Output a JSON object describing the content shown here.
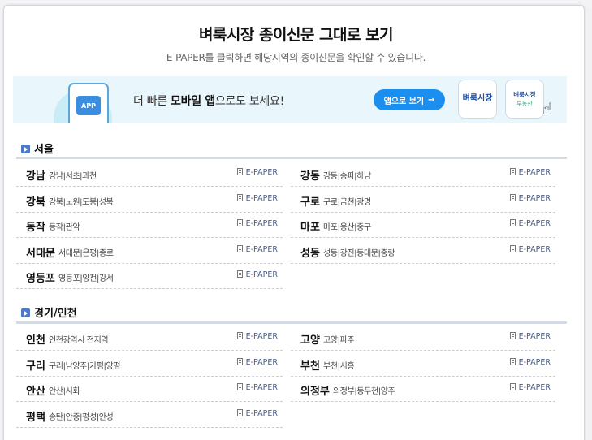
{
  "header": {
    "title": "벼룩시장 종이신문 그대로 보기",
    "subtitle": "E-PAPER를 클릭하면 해당지역의 종이신문을 확인할 수 있습니다."
  },
  "banner": {
    "app_icon_label": "APP",
    "text_before": "더 빠른 ",
    "text_bold": "모바일 앱",
    "text_after": "으로도 보세요!",
    "button_label": "앱으로 보기",
    "button_arrow": "→",
    "tile1_label": "벼룩시장",
    "tile2_label": "벼룩시장",
    "tile2_sub": "부동산",
    "hand_glyph": "☝"
  },
  "epaper_label": "E-PAPER",
  "sections": [
    {
      "title": "서울",
      "left": [
        {
          "city": "강남",
          "areas": "강남|서초|과천"
        },
        {
          "city": "강북",
          "areas": "강북|노원|도봉|성북"
        },
        {
          "city": "동작",
          "areas": "동작|관악"
        },
        {
          "city": "서대문",
          "areas": "서대문|은평|종로"
        },
        {
          "city": "영등포",
          "areas": "영등포|양천|강서"
        }
      ],
      "right": [
        {
          "city": "강동",
          "areas": "강동|송파|하남"
        },
        {
          "city": "구로",
          "areas": "구로|금천|광명"
        },
        {
          "city": "마포",
          "areas": "마포|용산|중구"
        },
        {
          "city": "성동",
          "areas": "성동|광진|동대문|중랑"
        }
      ]
    },
    {
      "title": "경기/인천",
      "left": [
        {
          "city": "인천",
          "areas": "인천광역시 전지역"
        },
        {
          "city": "구리",
          "areas": "구리|남양주|가평|양평"
        },
        {
          "city": "안산",
          "areas": "안산|시화"
        },
        {
          "city": "평택",
          "areas": "송탄|안중|평성|안성"
        }
      ],
      "right": [
        {
          "city": "고양",
          "areas": "고양|파주"
        },
        {
          "city": "부천",
          "areas": "부천|시흥"
        },
        {
          "city": "의정부",
          "areas": "의정부|동두천|양주"
        }
      ]
    }
  ]
}
